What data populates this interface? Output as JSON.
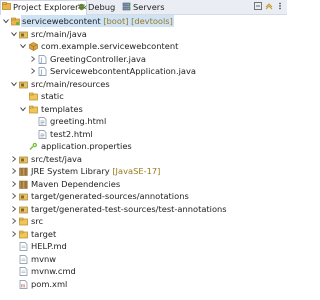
{
  "tabs": [
    {
      "label": "Project Explorer",
      "icon": "project-explorer-icon",
      "active": true
    },
    {
      "label": "Debug",
      "icon": "debug-icon",
      "active": false
    },
    {
      "label": "Servers",
      "icon": "servers-icon",
      "active": false
    }
  ],
  "tree": {
    "items": [
      {
        "label": "servicewebcontent",
        "decoration": " [boot] [devtools]",
        "icon": "project-icon",
        "expanded": true
      },
      {
        "label": "src/main/java",
        "icon": "source-folder-icon",
        "expanded": true
      },
      {
        "label": "com.example.servicewebcontent",
        "icon": "package-icon",
        "expanded": true
      },
      {
        "label": "GreetingController.java",
        "icon": "java-file-icon",
        "expanded": false
      },
      {
        "label": "ServicewebcontentApplication.java",
        "icon": "java-file-icon",
        "expanded": false
      },
      {
        "label": "src/main/resources",
        "icon": "source-folder-icon",
        "expanded": true
      },
      {
        "label": "static",
        "icon": "folder-icon",
        "expanded": false
      },
      {
        "label": "templates",
        "icon": "folder-icon",
        "expanded": true
      },
      {
        "label": "greeting.html",
        "icon": "html-file-icon"
      },
      {
        "label": "test2.html",
        "icon": "html-file-icon"
      },
      {
        "label": "application.properties",
        "icon": "properties-file-icon"
      },
      {
        "label": "src/test/java",
        "icon": "source-folder-icon",
        "expanded": false
      },
      {
        "label": "JRE System Library",
        "decoration": " [JavaSE-17]",
        "icon": "library-icon",
        "expanded": false
      },
      {
        "label": "Maven Dependencies",
        "icon": "library-icon",
        "expanded": false
      },
      {
        "label": "target/generated-sources/annotations",
        "icon": "source-folder-icon",
        "expanded": false
      },
      {
        "label": "target/generated-test-sources/test-annotations",
        "icon": "source-folder-icon",
        "expanded": false
      },
      {
        "label": "src",
        "icon": "folder-icon",
        "expanded": false
      },
      {
        "label": "target",
        "icon": "folder-icon",
        "expanded": false
      },
      {
        "label": "HELP.md",
        "icon": "file-icon"
      },
      {
        "label": "mvnw",
        "icon": "file-icon"
      },
      {
        "label": "mvnw.cmd",
        "icon": "file-icon"
      },
      {
        "label": "pom.xml",
        "icon": "xml-file-icon"
      }
    ]
  },
  "colors": {
    "selection": "#cfe3f7",
    "folder": "#e8b64c",
    "source_folder": "#c9a24a",
    "package": "#d39b3a",
    "java": "#4a7ab5",
    "decoration": "#9a7a1e"
  }
}
